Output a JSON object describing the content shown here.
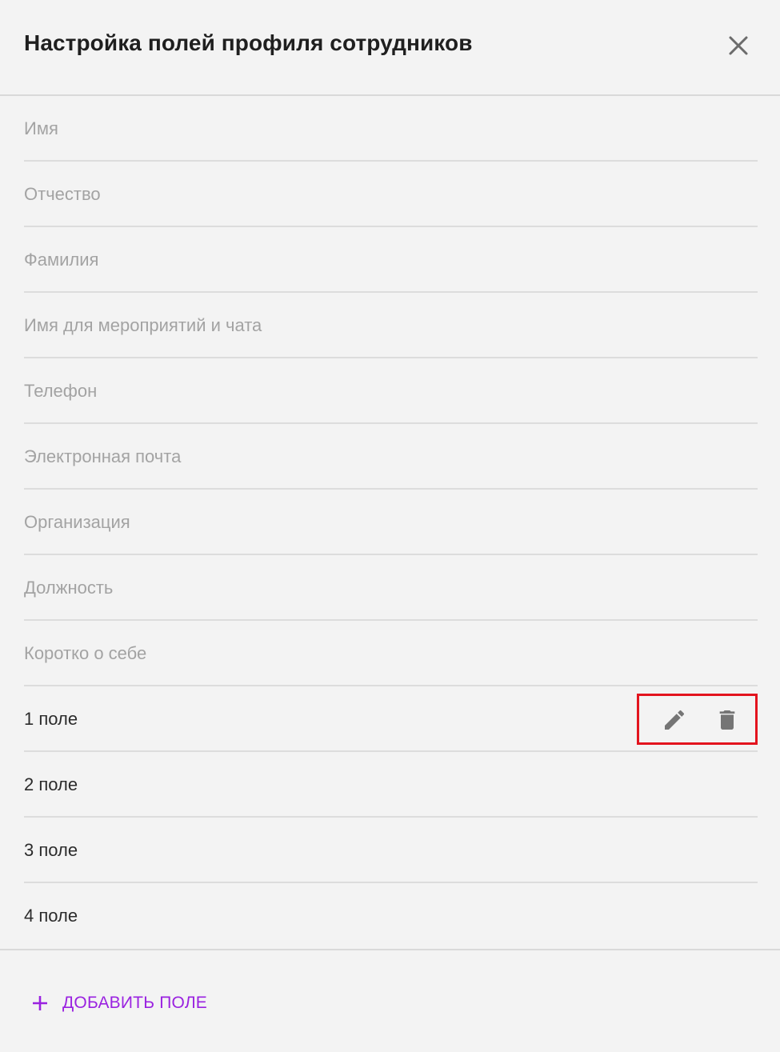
{
  "dialog": {
    "title": "Настройка полей профиля сотрудников",
    "close_icon": "close-icon"
  },
  "fields": [
    {
      "label": "Имя",
      "type": "system"
    },
    {
      "label": "Отчество",
      "type": "system"
    },
    {
      "label": "Фамилия",
      "type": "system"
    },
    {
      "label": "Имя для мероприятий и чата",
      "type": "system"
    },
    {
      "label": "Телефон",
      "type": "system"
    },
    {
      "label": "Электронная почта",
      "type": "system"
    },
    {
      "label": "Организация",
      "type": "system"
    },
    {
      "label": "Должность",
      "type": "system"
    },
    {
      "label": "Коротко о себе",
      "type": "system"
    },
    {
      "label": "1 поле",
      "type": "custom",
      "actions": [
        "pencil-icon",
        "trash-icon"
      ],
      "highlighted": true
    },
    {
      "label": "2 поле",
      "type": "custom"
    },
    {
      "label": "3 поле",
      "type": "custom"
    },
    {
      "label": "4 поле",
      "type": "custom"
    }
  ],
  "footer": {
    "add_button_label": "ДОБАВИТЬ ПОЛЕ",
    "add_icon": "plus-icon"
  },
  "colors": {
    "accent": "#9a22e0",
    "highlight_border": "#e3141e",
    "system_text": "#a3a3a3",
    "custom_text": "#2b2b2b"
  }
}
